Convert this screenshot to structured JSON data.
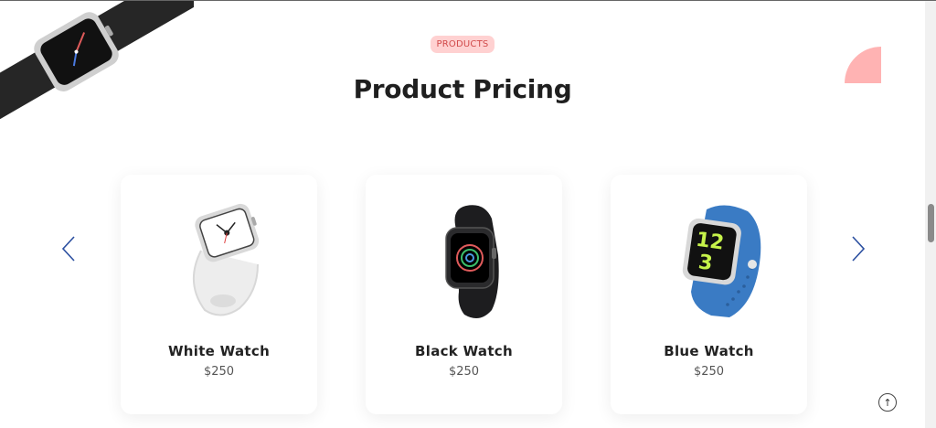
{
  "section": {
    "badge": "PRODUCTS",
    "title": "Product Pricing"
  },
  "products": [
    {
      "name": "White Watch",
      "price": "$250"
    },
    {
      "name": "Black Watch",
      "price": "$250"
    },
    {
      "name": "Blue Watch",
      "price": "$250"
    }
  ],
  "icons": {
    "prev": "chevron-left-icon",
    "next": "chevron-right-icon",
    "scroll_top": "arrow-up-icon"
  },
  "scroll_top_glyph": "↑",
  "colors": {
    "badge_bg": "#ffd1d1",
    "badge_text": "#d14a4a",
    "accent_shape": "#ffb3b3",
    "arrow": "#2b4fa0",
    "title": "#1f1f1f"
  }
}
